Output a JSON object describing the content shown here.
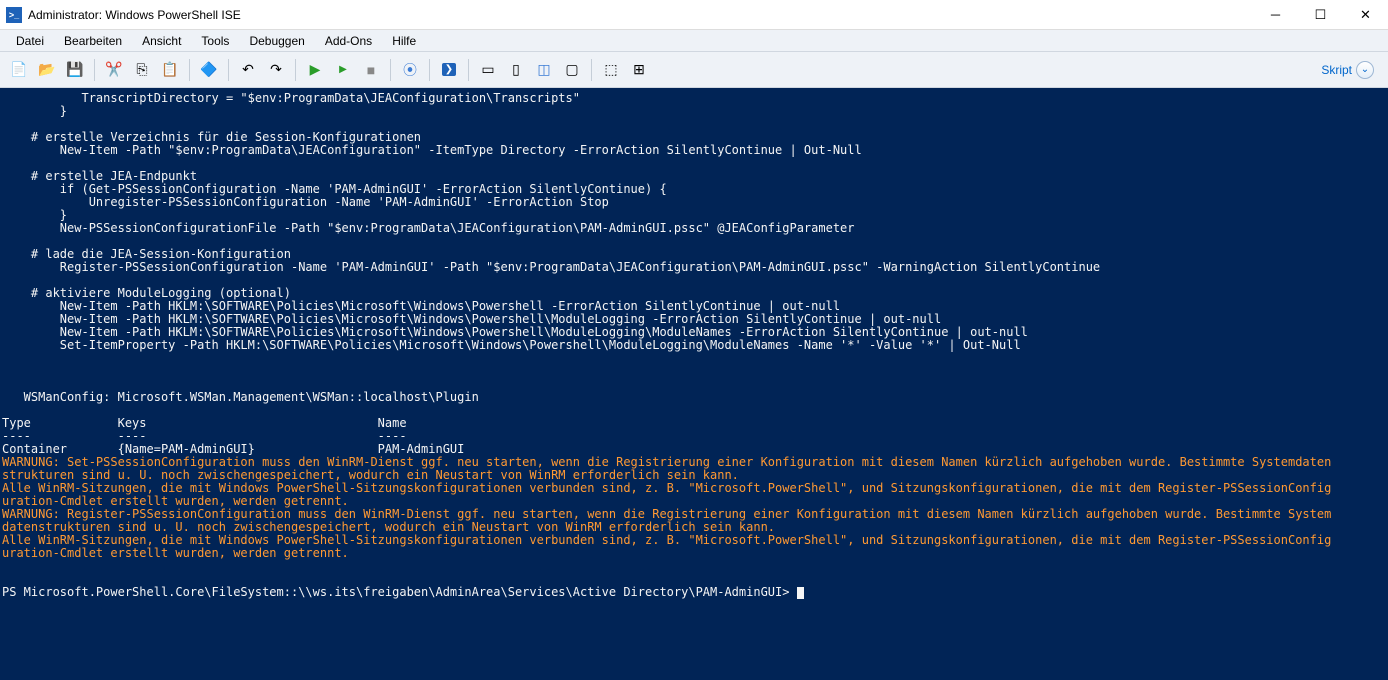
{
  "window": {
    "title": "Administrator: Windows PowerShell ISE"
  },
  "menu": [
    "Datei",
    "Bearbeiten",
    "Ansicht",
    "Tools",
    "Debuggen",
    "Add-Ons",
    "Hilfe"
  ],
  "skript_label": "Skript",
  "console": {
    "script_lines": [
      "           TranscriptDirectory = \"$env:ProgramData\\JEAConfiguration\\Transcripts\"",
      "        }",
      "",
      "    # erstelle Verzeichnis für die Session-Konfigurationen",
      "        New-Item -Path \"$env:ProgramData\\JEAConfiguration\" -ItemType Directory -ErrorAction SilentlyContinue | Out-Null",
      "",
      "    # erstelle JEA-Endpunkt",
      "        if (Get-PSSessionConfiguration -Name 'PAM-AdminGUI' -ErrorAction SilentlyContinue) {",
      "            Unregister-PSSessionConfiguration -Name 'PAM-AdminGUI' -ErrorAction Stop",
      "        }",
      "        New-PSSessionConfigurationFile -Path \"$env:ProgramData\\JEAConfiguration\\PAM-AdminGUI.pssc\" @JEAConfigParameter",
      "",
      "    # lade die JEA-Session-Konfiguration",
      "        Register-PSSessionConfiguration -Name 'PAM-AdminGUI' -Path \"$env:ProgramData\\JEAConfiguration\\PAM-AdminGUI.pssc\" -WarningAction SilentlyContinue",
      "",
      "    # aktiviere ModuleLogging (optional)",
      "        New-Item -Path HKLM:\\SOFTWARE\\Policies\\Microsoft\\Windows\\Powershell -ErrorAction SilentlyContinue | out-null",
      "        New-Item -Path HKLM:\\SOFTWARE\\Policies\\Microsoft\\Windows\\Powershell\\ModuleLogging -ErrorAction SilentlyContinue | out-null",
      "        New-Item -Path HKLM:\\SOFTWARE\\Policies\\Microsoft\\Windows\\Powershell\\ModuleLogging\\ModuleNames -ErrorAction SilentlyContinue | out-null",
      "        Set-ItemProperty -Path HKLM:\\SOFTWARE\\Policies\\Microsoft\\Windows\\Powershell\\ModuleLogging\\ModuleNames -Name '*' -Value '*' | Out-Null",
      "",
      "",
      "",
      "   WSManConfig: Microsoft.WSMan.Management\\WSMan::localhost\\Plugin",
      "",
      "Type            Keys                                Name",
      "----            ----                                ----",
      "Container       {Name=PAM-AdminGUI}                 PAM-AdminGUI"
    ],
    "warn_lines": [
      "WARNUNG: Set-PSSessionConfiguration muss den WinRM-Dienst ggf. neu starten, wenn die Registrierung einer Konfiguration mit diesem Namen kürzlich aufgehoben wurde. Bestimmte Systemdaten",
      "strukturen sind u. U. noch zwischengespeichert, wodurch ein Neustart von WinRM erforderlich sein kann.",
      "Alle WinRM-Sitzungen, die mit Windows PowerShell-Sitzungskonfigurationen verbunden sind, z. B. \"Microsoft.PowerShell\", und Sitzungskonfigurationen, die mit dem Register-PSSessionConfig",
      "uration-Cmdlet erstellt wurden, werden getrennt.",
      "WARNUNG: Register-PSSessionConfiguration muss den WinRM-Dienst ggf. neu starten, wenn die Registrierung einer Konfiguration mit diesem Namen kürzlich aufgehoben wurde. Bestimmte System",
      "datenstrukturen sind u. U. noch zwischengespeichert, wodurch ein Neustart von WinRM erforderlich sein kann.",
      "Alle WinRM-Sitzungen, die mit Windows PowerShell-Sitzungskonfigurationen verbunden sind, z. B. \"Microsoft.PowerShell\", und Sitzungskonfigurationen, die mit dem Register-PSSessionConfig",
      "uration-Cmdlet erstellt wurden, werden getrennt."
    ],
    "prompt": "PS Microsoft.PowerShell.Core\\FileSystem::\\\\ws.its\\freigaben\\AdminArea\\Services\\Active Directory\\PAM-AdminGUI> "
  }
}
